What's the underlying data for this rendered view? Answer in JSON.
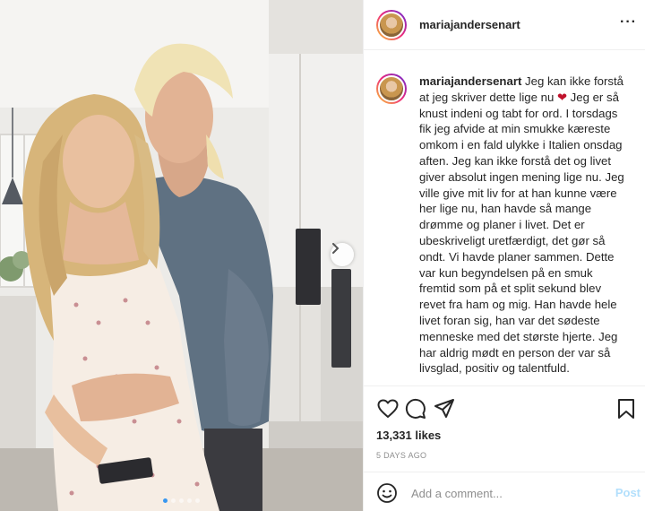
{
  "post": {
    "username": "mariajandersenart",
    "caption_username": "mariajandersenart",
    "caption_before_emoji": " Jeg kan ikke forstå at jeg skriver dette lige nu ",
    "caption_emoji": "❤",
    "caption_after_emoji": " Jeg er så knust indeni og tabt for ord. I torsdags fik jeg afvide at min smukke kæreste omkom i en fald ulykke i Italien onsdag aften. Jeg kan ikke forstå det og livet giver absolut ingen mening lige nu. Jeg ville give mit liv for at han kunne være her lige nu, han havde så mange drømme og planer i livet. Det er ubeskriveligt uretfærdigt, det gør så ondt. Vi havde planer sammen. Dette var kun begyndelsen på en smuk fremtid som på et split sekund blev revet fra ham og mig. Han havde hele livet foran sig, han var det sødeste menneske med det største hjerte. Jeg har aldrig mødt en person der var så livsglad, positiv og talentfuld.",
    "likes": "13,331 likes",
    "time_ago": "5 DAYS AGO"
  },
  "carousel": {
    "slide_count": 5,
    "active_index": 0
  },
  "comment": {
    "placeholder": "Add a comment...",
    "post_label": "Post"
  },
  "icons": {
    "more": "more-options-icon",
    "like": "heart-icon",
    "comment": "comment-icon",
    "share": "share-icon",
    "save": "bookmark-icon",
    "next": "chevron-right-icon",
    "emoji": "emoji-icon"
  },
  "colors": {
    "text": "#262626",
    "secondary": "#8e8e8e",
    "link_disabled": "#b2dffc",
    "dot_active": "#3897f0",
    "border": "#efefef"
  }
}
